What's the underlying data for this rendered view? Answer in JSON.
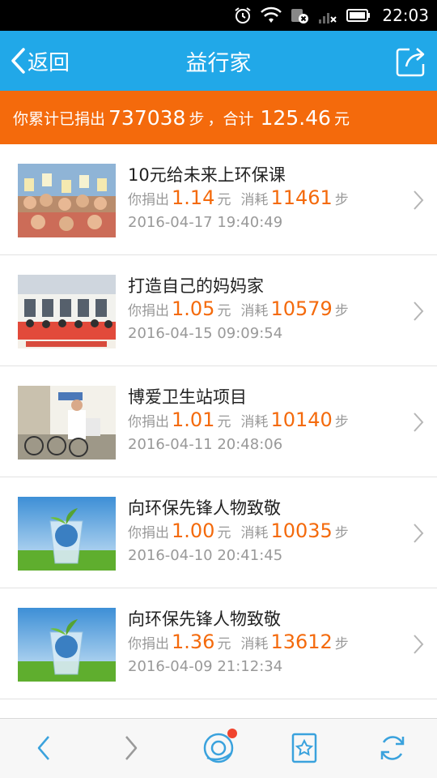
{
  "status_bar": {
    "time": "22:03",
    "icons": [
      "alarm-icon",
      "wifi-icon",
      "data-off-icon",
      "signal-icon",
      "battery-icon"
    ]
  },
  "nav": {
    "back_label": "返回",
    "title": "益行家",
    "share_icon": "share-icon"
  },
  "summary": {
    "prefix": "你累计已捐出",
    "steps": "737038",
    "steps_unit": "步",
    "sep": "，合计",
    "amount": "125.46",
    "amount_unit": "元"
  },
  "labels": {
    "donated": "你捐出",
    "yuan": "元",
    "consumed": "消耗",
    "steps_unit": "步"
  },
  "items": [
    {
      "title": "10元给未来上环保课",
      "amount": "1.14",
      "steps": "11461",
      "time": "2016-04-17 19:40:49"
    },
    {
      "title": "打造自己的妈妈家",
      "amount": "1.05",
      "steps": "10579",
      "time": "2016-04-15 09:09:54"
    },
    {
      "title": "博爱卫生站项目",
      "amount": "1.01",
      "steps": "10140",
      "time": "2016-04-11 20:48:06"
    },
    {
      "title": "向环保先锋人物致敬",
      "amount": "1.00",
      "steps": "10035",
      "time": "2016-04-10 20:41:45"
    },
    {
      "title": "向环保先锋人物致敬",
      "amount": "1.36",
      "steps": "13612",
      "time": "2016-04-09 21:12:34"
    }
  ],
  "bottom_bar": [
    "back-arrow-icon",
    "forward-arrow-icon",
    "qq-browser-icon",
    "bookmark-star-icon",
    "refresh-icon"
  ],
  "colors": {
    "nav_blue": "#21a8e8",
    "accent_orange": "#f46a0c",
    "muted_text": "#999999",
    "notify_dot": "#f0442e"
  }
}
